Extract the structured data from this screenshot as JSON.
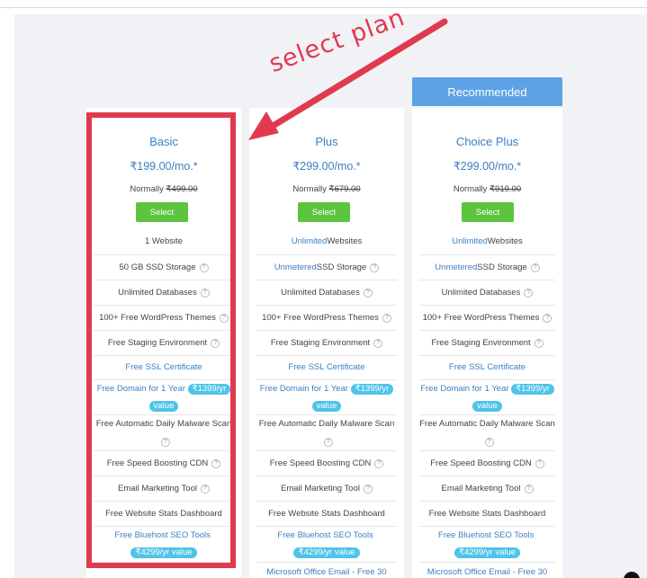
{
  "annotation": {
    "text": "select plan"
  },
  "recommended_label": "Recommended",
  "plans": [
    {
      "name": "Basic",
      "price": "₹199.00/mo.*",
      "normally_label": "Normally",
      "normally_price": "₹499.00",
      "select_label": "Select",
      "features": {
        "websites": {
          "hl": "",
          "text": "1 Website"
        },
        "storage": {
          "hl": "",
          "text": "50 GB SSD Storage"
        },
        "databases": "Unlimited Databases",
        "themes": "100+ Free WordPress Themes",
        "staging": "Free Staging Environment",
        "ssl": "Free SSL Certificate",
        "domain": "Free Domain for 1 Year",
        "domain_value_a": "₹1399/yr",
        "domain_value_b": "value",
        "malware": "Free Automatic Daily Malware Scan",
        "cdn": "Free Speed Boosting CDN",
        "email_marketing": "Email Marketing Tool",
        "stats": "Free Website Stats Dashboard",
        "seo": "Free Bluehost SEO Tools",
        "seo_value": "₹4299/yr value"
      }
    },
    {
      "name": "Plus",
      "price": "₹299.00/mo.*",
      "normally_label": "Normally",
      "normally_price": "₹679.00",
      "select_label": "Select",
      "features": {
        "websites": {
          "hl": "Unlimited",
          "text": " Websites"
        },
        "storage": {
          "hl": "Unmetered",
          "text": " SSD Storage"
        },
        "databases": "Unlimited Databases",
        "themes": "100+ Free WordPress Themes",
        "staging": "Free Staging Environment",
        "ssl": "Free SSL Certificate",
        "domain": "Free Domain for 1 Year",
        "domain_value_a": "₹1399/yr",
        "domain_value_b": "value",
        "malware": "Free Automatic Daily Malware Scan",
        "cdn": "Free Speed Boosting CDN",
        "email_marketing": "Email Marketing Tool",
        "stats": "Free Website Stats Dashboard",
        "seo": "Free Bluehost SEO Tools",
        "seo_value": "₹4299/yr value",
        "office": "Microsoft Office Email - Free 30"
      }
    },
    {
      "name": "Choice Plus",
      "price": "₹299.00/mo.*",
      "normally_label": "Normally",
      "normally_price": "₹919.00",
      "select_label": "Select",
      "features": {
        "websites": {
          "hl": "Unlimited",
          "text": " Websites"
        },
        "storage": {
          "hl": "Unmetered",
          "text": " SSD Storage"
        },
        "databases": "Unlimited Databases",
        "themes": "100+ Free WordPress Themes",
        "staging": "Free Staging Environment",
        "ssl": "Free SSL Certificate",
        "domain": "Free Domain for 1 Year",
        "domain_value_a": "₹1399/yr",
        "domain_value_b": "value",
        "malware": "Free Automatic Daily Malware Scan",
        "cdn": "Free Speed Boosting CDN",
        "email_marketing": "Email Marketing Tool",
        "stats": "Free Website Stats Dashboard",
        "seo": "Free Bluehost SEO Tools",
        "seo_value": "₹4299/yr value",
        "office": "Microsoft Office Email - Free 30"
      }
    }
  ],
  "colors": {
    "accent_blue": "#3c7fc2",
    "select_green": "#5cc43f",
    "pill_cyan": "#4fc3e8",
    "recommended_blue": "#5ea2e6",
    "annotation_red": "#e13a4f"
  },
  "icons": [
    "help-circle-icon",
    "arrow-icon"
  ]
}
